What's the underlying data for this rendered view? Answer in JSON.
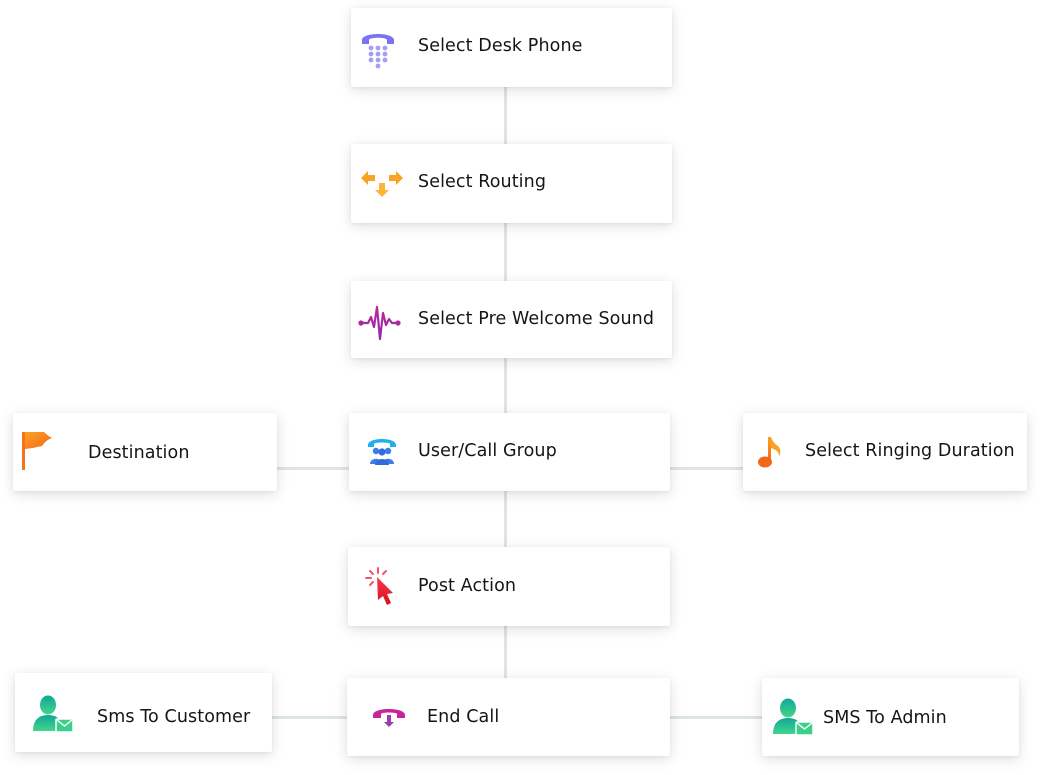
{
  "diagram": {
    "type": "call-flow",
    "connector_color": "#dde5e5",
    "nodes": [
      {
        "id": "desk-phone",
        "label": "Select Desk Phone",
        "icon": "desk-phone-icon",
        "icon_color": "#7b73f0"
      },
      {
        "id": "routing",
        "label": "Select Routing",
        "icon": "routing-arrows-icon",
        "icon_color": "#f9a324"
      },
      {
        "id": "pre-welcome-sound",
        "label": "Select Pre Welcome Sound",
        "icon": "sound-wave-icon",
        "icon_color": "#b0279c"
      },
      {
        "id": "destination",
        "label": "Destination",
        "icon": "flag-icon",
        "icon_color": "#f7801a"
      },
      {
        "id": "user-call-group",
        "label": "User/Call Group",
        "icon": "call-group-icon",
        "icon_color": "#1e9ce8"
      },
      {
        "id": "ringing-duration",
        "label": "Select Ringing Duration",
        "icon": "music-note-icon",
        "icon_color": "#f47a1c"
      },
      {
        "id": "post-action",
        "label": "Post Action",
        "icon": "cursor-click-icon",
        "icon_color": "#e8192c"
      },
      {
        "id": "sms-customer",
        "label": "Sms To Customer",
        "icon": "user-sms-icon",
        "icon_color": "#2cc27e"
      },
      {
        "id": "end-call",
        "label": "End Call",
        "icon": "end-call-icon",
        "icon_color": "#c9259a"
      },
      {
        "id": "sms-admin",
        "label": "SMS To Admin",
        "icon": "user-sms-icon",
        "icon_color": "#2cc27e"
      }
    ],
    "edges": [
      {
        "from": "desk-phone",
        "to": "routing"
      },
      {
        "from": "routing",
        "to": "pre-welcome-sound"
      },
      {
        "from": "pre-welcome-sound",
        "to": "user-call-group"
      },
      {
        "from": "user-call-group",
        "to": "destination"
      },
      {
        "from": "user-call-group",
        "to": "ringing-duration"
      },
      {
        "from": "user-call-group",
        "to": "post-action"
      },
      {
        "from": "post-action",
        "to": "end-call"
      },
      {
        "from": "end-call",
        "to": "sms-customer"
      },
      {
        "from": "end-call",
        "to": "sms-admin"
      }
    ]
  }
}
